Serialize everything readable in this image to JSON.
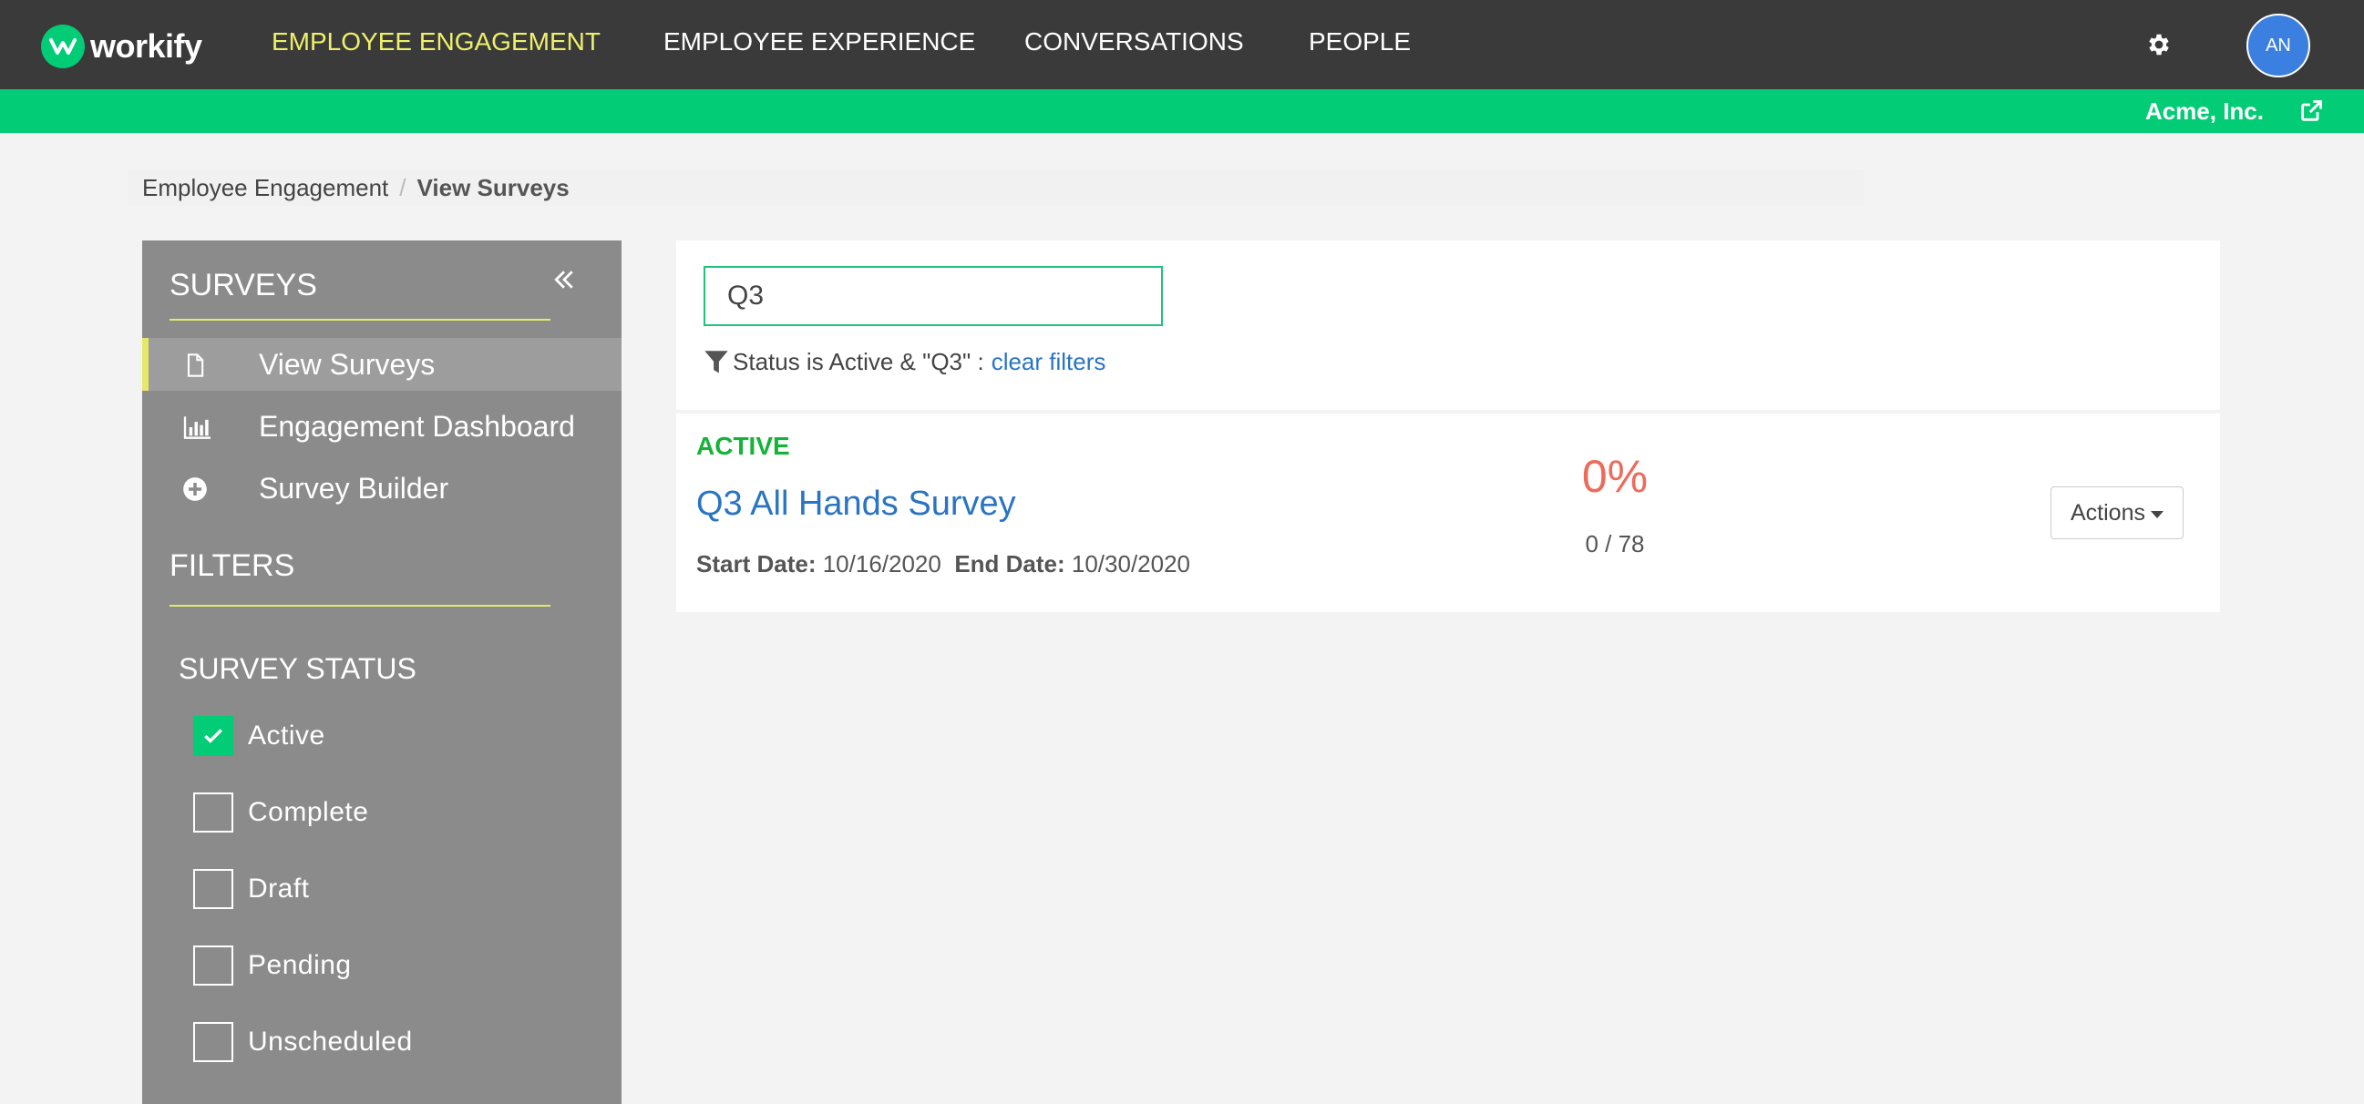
{
  "app": {
    "brand": "workify"
  },
  "nav": {
    "items": [
      {
        "label": "EMPLOYEE ENGAGEMENT",
        "active": true
      },
      {
        "label": "EMPLOYEE EXPERIENCE",
        "active": false
      },
      {
        "label": "CONVERSATIONS",
        "active": false
      },
      {
        "label": "PEOPLE",
        "active": false
      }
    ],
    "settings_icon": "gear-icon",
    "avatar_initials": "AN"
  },
  "org": {
    "name": "Acme, Inc.",
    "icon": "external-link-icon"
  },
  "breadcrumb": {
    "parent": "Employee Engagement",
    "separator": "/",
    "current": "View Surveys"
  },
  "sidebar": {
    "surveys_heading": "SURVEYS",
    "collapse_icon": "double-chevron-left-icon",
    "items": [
      {
        "label": "View Surveys",
        "icon": "document-icon",
        "active": true
      },
      {
        "label": "Engagement Dashboard",
        "icon": "bar-chart-icon",
        "active": false
      },
      {
        "label": "Survey Builder",
        "icon": "plus-circle-icon",
        "active": false
      }
    ],
    "filters_heading": "FILTERS",
    "status_heading": "SURVEY STATUS",
    "statuses": [
      {
        "label": "Active",
        "checked": true
      },
      {
        "label": "Complete",
        "checked": false
      },
      {
        "label": "Draft",
        "checked": false
      },
      {
        "label": "Pending",
        "checked": false
      },
      {
        "label": "Unscheduled",
        "checked": false
      }
    ]
  },
  "search": {
    "value": "Q3",
    "placeholder": ""
  },
  "filter_summary": {
    "text": "Status is Active &  \"Q3\"  :",
    "clear_label": "clear filters"
  },
  "survey": {
    "status": "ACTIVE",
    "title": "Q3 All Hands Survey",
    "start_label": "Start Date:",
    "start_date": "10/16/2020",
    "end_label": "End Date:",
    "end_date": "10/30/2020",
    "response_rate": "0%",
    "responses": "0 / 78",
    "actions_label": "Actions"
  },
  "colors": {
    "topbar": "#3a3a3a",
    "brand_green": "#03cc76",
    "nav_active": "#eef06a",
    "sidebar": "#8b8b8b",
    "accent_yellow": "#e5e96a",
    "link_blue": "#2a74c4",
    "status_green": "#16b338",
    "rate_red": "#ec6b5c"
  }
}
